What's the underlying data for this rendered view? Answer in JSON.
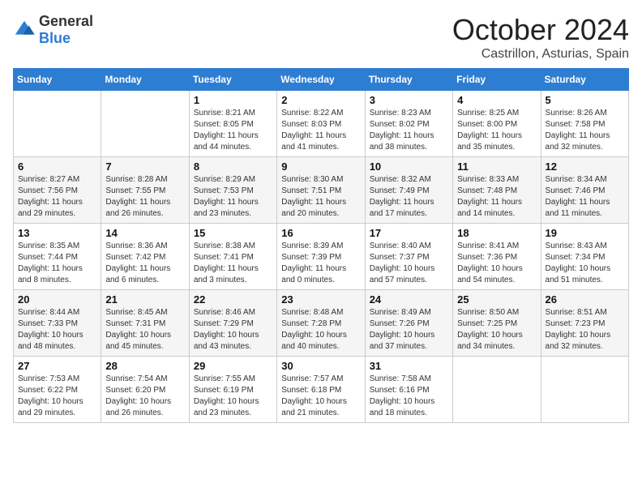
{
  "logo": {
    "general": "General",
    "blue": "Blue"
  },
  "title": "October 2024",
  "location": "Castrillon, Asturias, Spain",
  "days_of_week": [
    "Sunday",
    "Monday",
    "Tuesday",
    "Wednesday",
    "Thursday",
    "Friday",
    "Saturday"
  ],
  "weeks": [
    [
      {
        "day": "",
        "sunrise": "",
        "sunset": "",
        "daylight": ""
      },
      {
        "day": "",
        "sunrise": "",
        "sunset": "",
        "daylight": ""
      },
      {
        "day": "1",
        "sunrise": "Sunrise: 8:21 AM",
        "sunset": "Sunset: 8:05 PM",
        "daylight": "Daylight: 11 hours and 44 minutes."
      },
      {
        "day": "2",
        "sunrise": "Sunrise: 8:22 AM",
        "sunset": "Sunset: 8:03 PM",
        "daylight": "Daylight: 11 hours and 41 minutes."
      },
      {
        "day": "3",
        "sunrise": "Sunrise: 8:23 AM",
        "sunset": "Sunset: 8:02 PM",
        "daylight": "Daylight: 11 hours and 38 minutes."
      },
      {
        "day": "4",
        "sunrise": "Sunrise: 8:25 AM",
        "sunset": "Sunset: 8:00 PM",
        "daylight": "Daylight: 11 hours and 35 minutes."
      },
      {
        "day": "5",
        "sunrise": "Sunrise: 8:26 AM",
        "sunset": "Sunset: 7:58 PM",
        "daylight": "Daylight: 11 hours and 32 minutes."
      }
    ],
    [
      {
        "day": "6",
        "sunrise": "Sunrise: 8:27 AM",
        "sunset": "Sunset: 7:56 PM",
        "daylight": "Daylight: 11 hours and 29 minutes."
      },
      {
        "day": "7",
        "sunrise": "Sunrise: 8:28 AM",
        "sunset": "Sunset: 7:55 PM",
        "daylight": "Daylight: 11 hours and 26 minutes."
      },
      {
        "day": "8",
        "sunrise": "Sunrise: 8:29 AM",
        "sunset": "Sunset: 7:53 PM",
        "daylight": "Daylight: 11 hours and 23 minutes."
      },
      {
        "day": "9",
        "sunrise": "Sunrise: 8:30 AM",
        "sunset": "Sunset: 7:51 PM",
        "daylight": "Daylight: 11 hours and 20 minutes."
      },
      {
        "day": "10",
        "sunrise": "Sunrise: 8:32 AM",
        "sunset": "Sunset: 7:49 PM",
        "daylight": "Daylight: 11 hours and 17 minutes."
      },
      {
        "day": "11",
        "sunrise": "Sunrise: 8:33 AM",
        "sunset": "Sunset: 7:48 PM",
        "daylight": "Daylight: 11 hours and 14 minutes."
      },
      {
        "day": "12",
        "sunrise": "Sunrise: 8:34 AM",
        "sunset": "Sunset: 7:46 PM",
        "daylight": "Daylight: 11 hours and 11 minutes."
      }
    ],
    [
      {
        "day": "13",
        "sunrise": "Sunrise: 8:35 AM",
        "sunset": "Sunset: 7:44 PM",
        "daylight": "Daylight: 11 hours and 8 minutes."
      },
      {
        "day": "14",
        "sunrise": "Sunrise: 8:36 AM",
        "sunset": "Sunset: 7:42 PM",
        "daylight": "Daylight: 11 hours and 6 minutes."
      },
      {
        "day": "15",
        "sunrise": "Sunrise: 8:38 AM",
        "sunset": "Sunset: 7:41 PM",
        "daylight": "Daylight: 11 hours and 3 minutes."
      },
      {
        "day": "16",
        "sunrise": "Sunrise: 8:39 AM",
        "sunset": "Sunset: 7:39 PM",
        "daylight": "Daylight: 11 hours and 0 minutes."
      },
      {
        "day": "17",
        "sunrise": "Sunrise: 8:40 AM",
        "sunset": "Sunset: 7:37 PM",
        "daylight": "Daylight: 10 hours and 57 minutes."
      },
      {
        "day": "18",
        "sunrise": "Sunrise: 8:41 AM",
        "sunset": "Sunset: 7:36 PM",
        "daylight": "Daylight: 10 hours and 54 minutes."
      },
      {
        "day": "19",
        "sunrise": "Sunrise: 8:43 AM",
        "sunset": "Sunset: 7:34 PM",
        "daylight": "Daylight: 10 hours and 51 minutes."
      }
    ],
    [
      {
        "day": "20",
        "sunrise": "Sunrise: 8:44 AM",
        "sunset": "Sunset: 7:33 PM",
        "daylight": "Daylight: 10 hours and 48 minutes."
      },
      {
        "day": "21",
        "sunrise": "Sunrise: 8:45 AM",
        "sunset": "Sunset: 7:31 PM",
        "daylight": "Daylight: 10 hours and 45 minutes."
      },
      {
        "day": "22",
        "sunrise": "Sunrise: 8:46 AM",
        "sunset": "Sunset: 7:29 PM",
        "daylight": "Daylight: 10 hours and 43 minutes."
      },
      {
        "day": "23",
        "sunrise": "Sunrise: 8:48 AM",
        "sunset": "Sunset: 7:28 PM",
        "daylight": "Daylight: 10 hours and 40 minutes."
      },
      {
        "day": "24",
        "sunrise": "Sunrise: 8:49 AM",
        "sunset": "Sunset: 7:26 PM",
        "daylight": "Daylight: 10 hours and 37 minutes."
      },
      {
        "day": "25",
        "sunrise": "Sunrise: 8:50 AM",
        "sunset": "Sunset: 7:25 PM",
        "daylight": "Daylight: 10 hours and 34 minutes."
      },
      {
        "day": "26",
        "sunrise": "Sunrise: 8:51 AM",
        "sunset": "Sunset: 7:23 PM",
        "daylight": "Daylight: 10 hours and 32 minutes."
      }
    ],
    [
      {
        "day": "27",
        "sunrise": "Sunrise: 7:53 AM",
        "sunset": "Sunset: 6:22 PM",
        "daylight": "Daylight: 10 hours and 29 minutes."
      },
      {
        "day": "28",
        "sunrise": "Sunrise: 7:54 AM",
        "sunset": "Sunset: 6:20 PM",
        "daylight": "Daylight: 10 hours and 26 minutes."
      },
      {
        "day": "29",
        "sunrise": "Sunrise: 7:55 AM",
        "sunset": "Sunset: 6:19 PM",
        "daylight": "Daylight: 10 hours and 23 minutes."
      },
      {
        "day": "30",
        "sunrise": "Sunrise: 7:57 AM",
        "sunset": "Sunset: 6:18 PM",
        "daylight": "Daylight: 10 hours and 21 minutes."
      },
      {
        "day": "31",
        "sunrise": "Sunrise: 7:58 AM",
        "sunset": "Sunset: 6:16 PM",
        "daylight": "Daylight: 10 hours and 18 minutes."
      },
      {
        "day": "",
        "sunrise": "",
        "sunset": "",
        "daylight": ""
      },
      {
        "day": "",
        "sunrise": "",
        "sunset": "",
        "daylight": ""
      }
    ]
  ]
}
